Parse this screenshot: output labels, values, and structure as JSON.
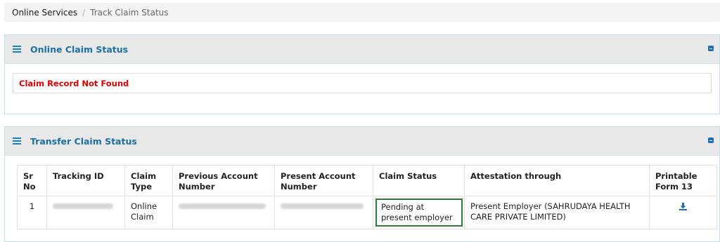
{
  "breadcrumb": {
    "home": "Online Services",
    "separator": "/",
    "current": "Track Claim Status"
  },
  "online_claim": {
    "title": "Online Claim Status",
    "message": "Claim Record Not Found"
  },
  "transfer_claim": {
    "title": "Transfer Claim Status",
    "headers": {
      "sr": "Sr No",
      "tracking": "Tracking ID",
      "type": "Claim Type",
      "prev": "Previous Account Number",
      "present": "Present Account Number",
      "status": "Claim Status",
      "attest": "Attestation through",
      "form": "Printable Form 13"
    },
    "rows": [
      {
        "sr": "1",
        "type": "Online Claim",
        "status": "Pending at present employer",
        "attest": "Present Employer (SAHRUDAYA HEALTH CARE PRIVATE LIMITED)",
        "download_icon": "download-icon"
      }
    ]
  },
  "colors": {
    "accent": "#1d6fa3",
    "error": "#e00000",
    "status_border": "#2e7d32"
  }
}
